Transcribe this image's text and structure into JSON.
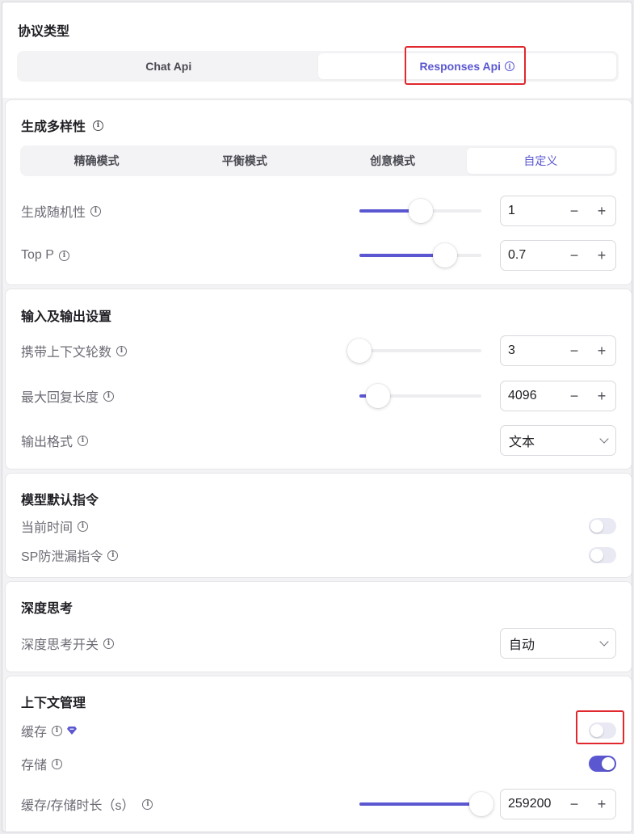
{
  "protocol": {
    "title": "协议类型",
    "options": [
      "Chat Api",
      "Responses Api"
    ],
    "selected": "Responses Api"
  },
  "diversity": {
    "title": "生成多样性",
    "modes": [
      "精确模式",
      "平衡模式",
      "创意模式",
      "自定义"
    ],
    "selected": "自定义",
    "temperature": {
      "label": "生成随机性",
      "value": "1",
      "fraction": 0.5
    },
    "top_p": {
      "label": "Top P",
      "value": "0.7",
      "fraction": 0.7
    }
  },
  "io": {
    "title": "输入及输出设置",
    "context_rounds": {
      "label": "携带上下文轮数",
      "value": "3",
      "fraction": 0.0
    },
    "max_length": {
      "label": "最大回复长度",
      "value": "4096",
      "fraction": 0.15
    },
    "output_format": {
      "label": "输出格式",
      "value": "文本"
    }
  },
  "instructions": {
    "title": "模型默认指令",
    "current_time": {
      "label": "当前时间",
      "enabled": false
    },
    "sp_leak": {
      "label": "SP防泄漏指令",
      "enabled": false
    }
  },
  "thinking": {
    "title": "深度思考",
    "switch": {
      "label": "深度思考开关",
      "value": "自动"
    }
  },
  "context": {
    "title": "上下文管理",
    "cache": {
      "label": "缓存",
      "enabled": false
    },
    "storage": {
      "label": "存储",
      "enabled": true
    },
    "duration": {
      "label": "缓存/存储时长（s）",
      "value": "259200",
      "fraction": 1.0
    }
  },
  "colors": {
    "accent": "#5b57d1",
    "highlight": "#e0282e"
  },
  "stepper": {
    "minus": "−",
    "plus": "+"
  }
}
